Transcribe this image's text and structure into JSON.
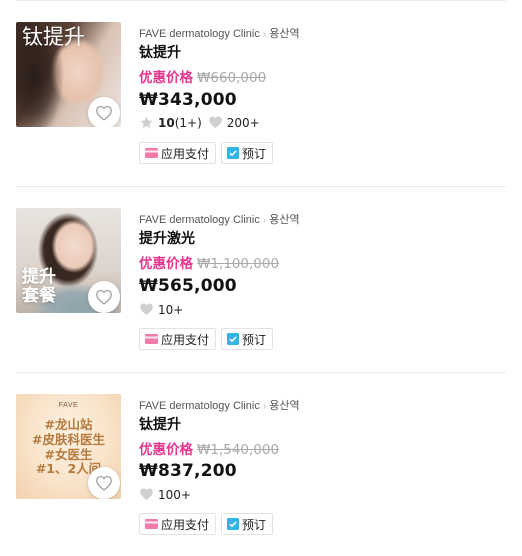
{
  "items": [
    {
      "clinic": "FAVE dermatology Clinic",
      "station": "용산역",
      "title": "钛提升",
      "promo_label": "优惠价格",
      "original_price": "₩660,000",
      "price": "₩343,000",
      "rating": "10",
      "rating_count": "(1+)",
      "likes": "200+",
      "thumb_text": "钛提升",
      "tags": [
        "应用支付",
        "预订"
      ]
    },
    {
      "clinic": "FAVE dermatology Clinic",
      "station": "용산역",
      "title": "提升激光",
      "promo_label": "优惠价格",
      "original_price": "₩1,100,000",
      "price": "₩565,000",
      "likes": "10+",
      "thumb_text": "提升\n套餐",
      "tags": [
        "应用支付",
        "预订"
      ]
    },
    {
      "clinic": "FAVE dermatology Clinic",
      "station": "용산역",
      "title": "钛提升",
      "promo_label": "优惠价格",
      "original_price": "₩1,540,000",
      "price": "₩837,200",
      "likes": "100+",
      "thumb_brand": "FAVE",
      "thumb_text": "#龙山站\n#皮肤科医生\n#女医生\n#1、2人间",
      "tags": [
        "应用支付",
        "预订"
      ]
    }
  ],
  "colors": {
    "promo": "#e8368f",
    "strike": "#aaaaaa",
    "pay_icon": "#f27ba8",
    "book_icon": "#2fb6e6"
  },
  "icons": {
    "heart": "heart-icon",
    "star": "star-icon",
    "pay": "card-icon",
    "book": "calendar-check-icon"
  }
}
